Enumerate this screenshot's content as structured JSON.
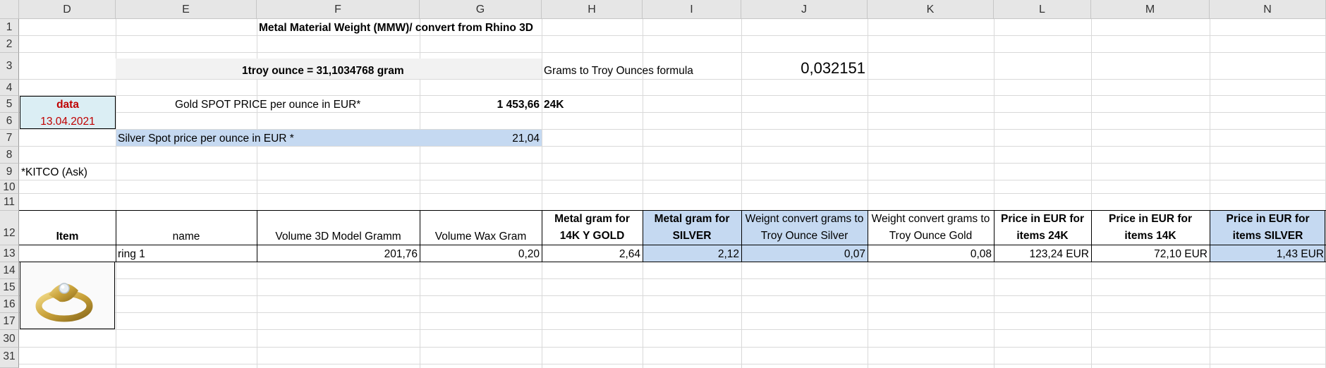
{
  "columns": [
    "D",
    "E",
    "F",
    "G",
    "H",
    "I",
    "J",
    "K",
    "L",
    "M",
    "N"
  ],
  "rows": [
    "1",
    "2",
    "3",
    "4",
    "5",
    "6",
    "7",
    "8",
    "9",
    "10",
    "11",
    "12",
    "13",
    "14",
    "15",
    "16",
    "17",
    "30",
    "31"
  ],
  "title": "Metal Material Weight (MMW)/ convert from Rhino 3D",
  "troy_ounce_label": "1troy ounce =  31,1034768 gram",
  "grams_to_troy_label": "Grams to Troy Ounces formula",
  "grams_to_troy_value": "0,032151",
  "data_label": "data",
  "data_date": "13.04.2021",
  "gold_spot_label": "Gold SPOT PRICE per ounce in EUR*",
  "gold_spot_value": "1 453,66",
  "gold_karat": "24K",
  "silver_spot_label": "Silver Spot price per ounce in EUR *",
  "silver_spot_value": "21,04",
  "kitco_note": "*KITCO (Ask)",
  "table": {
    "headers": {
      "item": "Item",
      "name": "name",
      "volume_3d": "Volume 3D Model Gramm",
      "volume_wax": "Volume Wax Gram",
      "metal_14k": "Metal gram for 14K Y GOLD",
      "metal_silver": "Metal gram for SILVER",
      "convert_silver": "Weignt convert grams to Troy Ounce Silver",
      "convert_gold": "Weight convert grams to Troy Ounce Gold",
      "price_24k": "Price in EUR for items 24K",
      "price_14k": "Price in EUR for items 14K",
      "price_silver": "Price in EUR for items SILVER"
    },
    "row": {
      "name": "ring 1",
      "volume_3d": "201,76",
      "volume_wax": "0,20",
      "metal_14k": "2,64",
      "metal_silver": "2,12",
      "convert_silver": "0,07",
      "convert_gold": "0,08",
      "price_24k": "123,24 EUR",
      "price_14k": "72,10 EUR",
      "price_silver": "1,43 EUR"
    }
  },
  "image_alt": "gold ring render"
}
